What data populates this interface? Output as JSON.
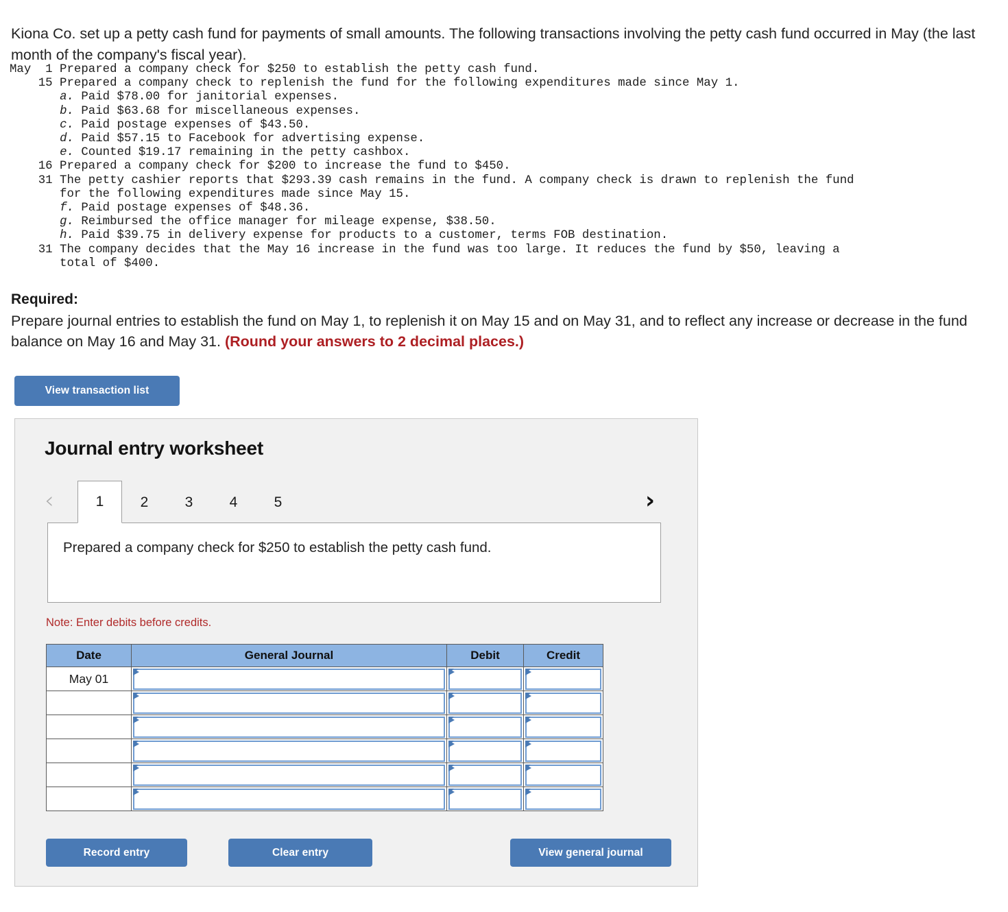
{
  "intro": {
    "paragraph": "Kiona Co. set up a petty cash fund for payments of small amounts. The following transactions involving the petty cash fund occurred in May (the last month of the company's fiscal year)."
  },
  "transactions": {
    "lines": [
      "May  1 Prepared a company check for $250 to establish the petty cash fund.",
      "    15 Prepared a company check to replenish the fund for the following expenditures made since May 1.",
      "       a. Paid $78.00 for janitorial expenses.",
      "       b. Paid $63.68 for miscellaneous expenses.",
      "       c. Paid postage expenses of $43.50.",
      "       d. Paid $57.15 to Facebook for advertising expense.",
      "       e. Counted $19.17 remaining in the petty cashbox.",
      "    16 Prepared a company check for $200 to increase the fund to $450.",
      "    31 The petty cashier reports that $293.39 cash remains in the fund. A company check is drawn to replenish the fund",
      "       for the following expenditures made since May 15.",
      "       f. Paid postage expenses of $48.36.",
      "       g. Reimbursed the office manager for mileage expense, $38.50.",
      "       h. Paid $39.75 in delivery expense for products to a customer, terms FOB destination.",
      "    31 The company decides that the May 16 increase in the fund was too large. It reduces the fund by $50, leaving a",
      "       total of $400."
    ]
  },
  "required": {
    "title": "Required:",
    "body": "Prepare journal entries to establish the fund on May 1, to replenish it on May 15 and on May 31, and to reflect any increase or decrease in the fund balance on May 16 and May 31. ",
    "emphasis": "(Round your answers to 2 decimal places.)"
  },
  "actions": {
    "view_transaction_list": "View transaction list",
    "record_entry": "Record entry",
    "clear_entry": "Clear entry",
    "view_general_journal": "View general journal"
  },
  "worksheet": {
    "title": "Journal entry worksheet",
    "prev_icon": "‹",
    "next_icon": "›",
    "tabs": [
      {
        "label": "1",
        "active": true
      },
      {
        "label": "2",
        "active": false
      },
      {
        "label": "3",
        "active": false
      },
      {
        "label": "4",
        "active": false
      },
      {
        "label": "5",
        "active": false
      }
    ],
    "transaction_text": "Prepared a company check for $250 to establish the petty cash fund.",
    "note": "Note: Enter debits before credits.",
    "table": {
      "headers": [
        "Date",
        "General Journal",
        "Debit",
        "Credit"
      ],
      "rows": [
        {
          "date": "May 01",
          "general_journal": "",
          "debit": "",
          "credit": ""
        },
        {
          "date": "",
          "general_journal": "",
          "debit": "",
          "credit": ""
        },
        {
          "date": "",
          "general_journal": "",
          "debit": "",
          "credit": ""
        },
        {
          "date": "",
          "general_journal": "",
          "debit": "",
          "credit": ""
        },
        {
          "date": "",
          "general_journal": "",
          "debit": "",
          "credit": ""
        },
        {
          "date": "",
          "general_journal": "",
          "debit": "",
          "credit": ""
        }
      ]
    }
  },
  "colors": {
    "button_blue": "#4a7ab5",
    "header_blue": "#8db4e2",
    "note_red": "#b02a2a",
    "emphasis_red": "#ad1f23",
    "panel_bg": "#f1f1f1"
  }
}
